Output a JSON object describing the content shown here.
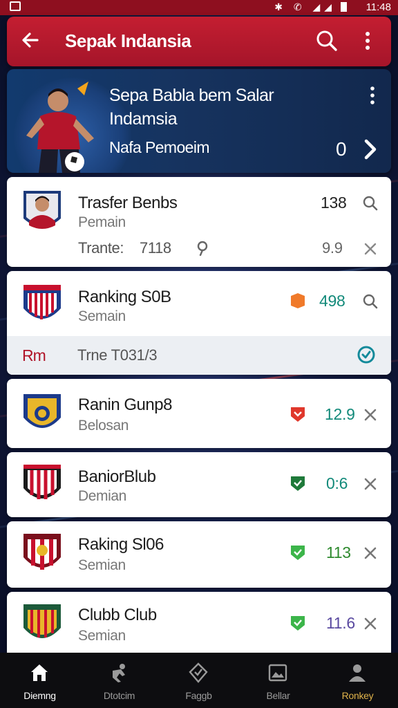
{
  "status_bar": {
    "time": "11:48"
  },
  "app_bar": {
    "title": "Sepak Indansia",
    "back_icon": "arrow-left-icon",
    "search_icon": "search-icon",
    "more_icon": "more-vert-icon"
  },
  "hero": {
    "line1": "Sepa Babla bem Salar",
    "line2": "Indamsia",
    "line3": "Nafa Pemoeim",
    "count": "0"
  },
  "cards": [
    {
      "name": "Trasfer Benbs",
      "sub": "Pemain",
      "value": "138",
      "extra_label": "Trante:",
      "extra_value": "7118",
      "extra_right": "9.9"
    },
    {
      "name": "Ranking S0B",
      "sub": "Semain",
      "value": "498",
      "value_color": "#138a7a",
      "badge_color": "#f07a2a"
    },
    {
      "name": "Ranin Gunp8",
      "sub": "Belosan",
      "value": "12.9",
      "value_color": "#138a7a",
      "badge_color": "#e0382c"
    },
    {
      "name": "BaniorBlub",
      "sub": "Demian",
      "value": "0:6",
      "value_color": "#138a7a",
      "badge_color": "#1f7a3a"
    },
    {
      "name": "Raking Sl06",
      "sub": "Semian",
      "value": "113",
      "value_color": "#2e8a2e",
      "badge_color": "#3cb54a"
    },
    {
      "name": "Clubb Club",
      "sub": "Semian",
      "value": "11.6",
      "value_color": "#5a4aa0",
      "badge_color": "#3cb54a"
    }
  ],
  "sub_row": {
    "left": "Rm",
    "text": "Trne T031/3"
  },
  "bottom_nav": [
    {
      "label": "Diemng",
      "icon": "home-icon"
    },
    {
      "label": "Dtotcim",
      "icon": "player-icon"
    },
    {
      "label": "Faggb",
      "icon": "shield-icon"
    },
    {
      "label": "Bellar",
      "icon": "image-icon"
    },
    {
      "label": "Ronkey",
      "icon": "profile-icon"
    }
  ]
}
